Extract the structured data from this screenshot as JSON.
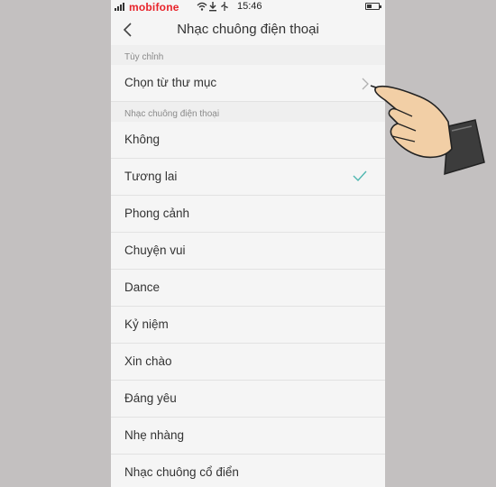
{
  "status_bar": {
    "carrier": "mobifone",
    "time": "15:46",
    "icons": [
      "signal-icon",
      "wifi-icon",
      "download-icon",
      "usb-icon",
      "app-icon",
      "battery-icon"
    ]
  },
  "header": {
    "title": "Nhạc chuông điện thoại",
    "back_icon": "chevron-left-icon"
  },
  "sections": [
    {
      "header": "Tùy chỉnh",
      "items": [
        {
          "label": "Chọn từ thư mục",
          "has_chevron": true
        }
      ]
    },
    {
      "header": "Nhạc chuông điện thoại",
      "items": [
        {
          "label": "Không"
        },
        {
          "label": "Tương lai",
          "selected": true
        },
        {
          "label": "Phong cảnh"
        },
        {
          "label": "Chuyện vui"
        },
        {
          "label": "Dance"
        },
        {
          "label": "Kỷ niệm"
        },
        {
          "label": "Xin chào"
        },
        {
          "label": "Đáng yêu"
        },
        {
          "label": "Nhẹ nhàng"
        },
        {
          "label": "Nhạc chuông cổ điển"
        }
      ]
    }
  ],
  "colors": {
    "background": "#c3c0c0",
    "screen": "#f5f5f5",
    "accent_check": "#4fb6b0",
    "carrier_red": "#e8232a"
  },
  "overlay": {
    "icon": "pointing-hand-icon"
  }
}
